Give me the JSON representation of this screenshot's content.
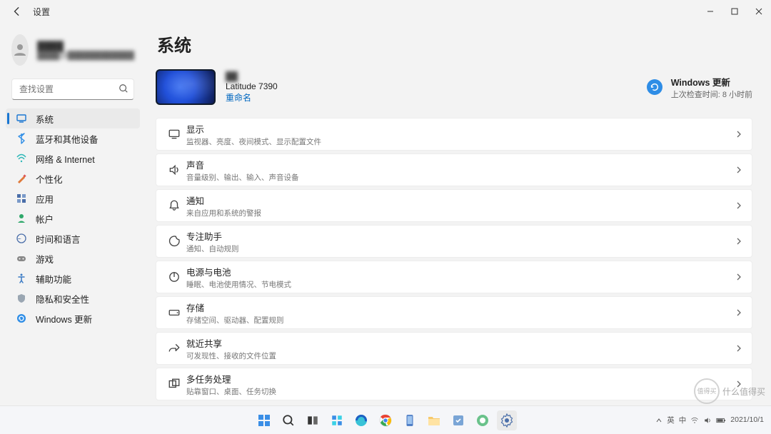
{
  "window": {
    "title": "设置",
    "controls": {
      "min": "min",
      "max": "max",
      "close": "close"
    }
  },
  "user": {
    "name_masked": "████",
    "email_masked": "████@████████████"
  },
  "search": {
    "placeholder": "查找设置"
  },
  "nav": [
    {
      "id": "system",
      "label": "系统",
      "active": true
    },
    {
      "id": "bluetooth",
      "label": "蓝牙和其他设备"
    },
    {
      "id": "network",
      "label": "网络 & Internet"
    },
    {
      "id": "personalization",
      "label": "个性化"
    },
    {
      "id": "apps",
      "label": "应用"
    },
    {
      "id": "accounts",
      "label": "帐户"
    },
    {
      "id": "time",
      "label": "时间和语言"
    },
    {
      "id": "gaming",
      "label": "游戏"
    },
    {
      "id": "accessibility",
      "label": "辅助功能"
    },
    {
      "id": "privacy",
      "label": "隐私和安全性"
    },
    {
      "id": "update",
      "label": "Windows 更新"
    }
  ],
  "page": {
    "title": "系统",
    "device": {
      "name_masked": "██",
      "model": "Latitude 7390",
      "rename": "重命名"
    },
    "windows_update": {
      "label": "Windows 更新",
      "sub": "上次检查时间: 8 小时前"
    },
    "cards": [
      {
        "id": "display",
        "title": "显示",
        "sub": "监视器、亮度、夜间模式、显示配置文件"
      },
      {
        "id": "sound",
        "title": "声音",
        "sub": "音量级别、输出、输入、声音设备"
      },
      {
        "id": "notifications",
        "title": "通知",
        "sub": "来自应用和系统的警报"
      },
      {
        "id": "focus",
        "title": "专注助手",
        "sub": "通知、自动规则"
      },
      {
        "id": "power",
        "title": "电源与电池",
        "sub": "睡眠、电池使用情况、节电模式"
      },
      {
        "id": "storage",
        "title": "存储",
        "sub": "存储空间、驱动器、配置规则"
      },
      {
        "id": "share",
        "title": "就近共享",
        "sub": "可发现性、接收的文件位置"
      },
      {
        "id": "multitask",
        "title": "多任务处理",
        "sub": "贴靠窗口、桌面、任务切换"
      }
    ]
  },
  "taskbar": {
    "items": [
      {
        "id": "start"
      },
      {
        "id": "search"
      },
      {
        "id": "taskview"
      },
      {
        "id": "widgets"
      },
      {
        "id": "edge"
      },
      {
        "id": "chrome"
      },
      {
        "id": "phone"
      },
      {
        "id": "explorer"
      },
      {
        "id": "tool1"
      },
      {
        "id": "tool2"
      },
      {
        "id": "settings",
        "active": true
      }
    ],
    "tray": {
      "ime1": "英",
      "ime2": "中",
      "date": "2021/10/1"
    }
  },
  "watermark": {
    "text": "什么值得买",
    "circle": "值得买"
  }
}
